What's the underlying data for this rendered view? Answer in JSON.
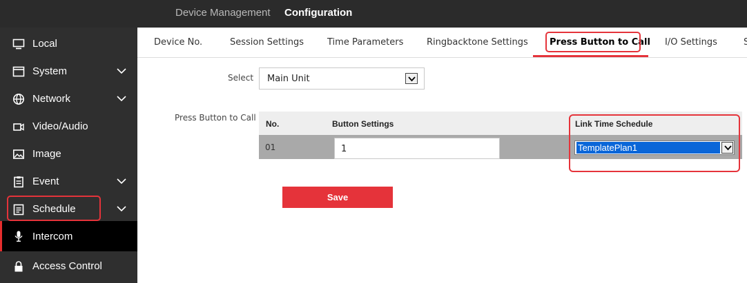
{
  "header": {
    "nav": [
      "Device Management",
      "Configuration"
    ]
  },
  "sidebar": {
    "items": [
      {
        "label": "Local",
        "icon": "monitor-icon"
      },
      {
        "label": "System",
        "icon": "system-window-icon"
      },
      {
        "label": "Network",
        "icon": "globe-icon"
      },
      {
        "label": "Video/Audio",
        "icon": "video-camera-icon"
      },
      {
        "label": "Image",
        "icon": "image-icon"
      },
      {
        "label": "Event",
        "icon": "clipboard-icon"
      },
      {
        "label": "Schedule",
        "icon": "schedule-icon"
      },
      {
        "label": "Intercom",
        "icon": "microphone-icon"
      },
      {
        "label": "Access Control",
        "icon": "lock-icon"
      }
    ]
  },
  "tabs": [
    "Device No.",
    "Session Settings",
    "Time Parameters",
    "Ringbacktone Settings",
    "Press Button to Call",
    "I/O Settings",
    "S"
  ],
  "form": {
    "select_label": "Select",
    "select_value": "Main Unit",
    "section_label": "Press Button to Call"
  },
  "table": {
    "headers": [
      "No.",
      "Button Settings",
      "Link Time Schedule"
    ],
    "rows": [
      {
        "no": "01",
        "button": "1",
        "schedule": "TemplatePlan1"
      }
    ]
  },
  "save_label": "Save",
  "colors": {
    "accent": "#e5333a",
    "sidebar_bg": "#2f2f2f",
    "topbar_bg": "#2b2b2b",
    "selection": "#0a66d8"
  }
}
